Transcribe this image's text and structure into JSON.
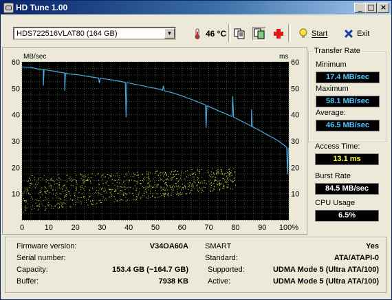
{
  "window": {
    "title": "HD Tune 1.00"
  },
  "toolbar": {
    "drive": "HDS722516VLAT80 (164 GB)",
    "temperature": "46 °C",
    "start_label": "Start",
    "exit_label": "Exit"
  },
  "chart_data": {
    "type": "line",
    "ylabel_left": "MB/sec",
    "ylabel_right": "ms",
    "y_ticks": [
      "60",
      "50",
      "40",
      "30",
      "20",
      "10"
    ],
    "y_ticks_right": [
      "60",
      "50",
      "40",
      "30",
      "20",
      "10"
    ],
    "x_ticks": [
      "0",
      "10",
      "20",
      "30",
      "40",
      "50",
      "60",
      "70",
      "80",
      "90",
      "100%"
    ],
    "ylim": [
      0,
      60
    ],
    "xlim": [
      0,
      100
    ],
    "grid": true,
    "transfer_rate": {
      "x": [
        0,
        2,
        4,
        5,
        6,
        7,
        8,
        9,
        10,
        12,
        14,
        16,
        18,
        20,
        22,
        24,
        26,
        28,
        30,
        32,
        34,
        36,
        38,
        40,
        42,
        44,
        46,
        48,
        50,
        52,
        54,
        56,
        58,
        60,
        62,
        64,
        66,
        68,
        70,
        72,
        74,
        76,
        78,
        80,
        82,
        84,
        86,
        88,
        90,
        92,
        94,
        96,
        98,
        100
      ],
      "y": [
        58.1,
        58,
        57.8,
        57.5,
        57.3,
        57.2,
        57.1,
        57,
        56.8,
        56.5,
        56.1,
        55.8,
        55.4,
        55.2,
        55,
        54.6,
        54.3,
        54,
        53.8,
        53.4,
        53.1,
        52.8,
        52.4,
        52,
        51.6,
        51.2,
        50.8,
        50.3,
        50,
        49.5,
        48.9,
        48.4,
        47.8,
        47.1,
        46.3,
        45.6,
        44.8,
        44,
        43.1,
        42.2,
        41.3,
        40.5,
        39.6,
        38.7,
        37.7,
        36.7,
        35.6,
        34.6,
        33.5,
        32.3,
        31.3,
        30.1,
        28.6,
        27
      ]
    },
    "dips": [
      {
        "x": 8,
        "y": 51
      },
      {
        "x": 16,
        "y": 49
      },
      {
        "x": 29,
        "y": 52
      },
      {
        "x": 39,
        "y": 39
      },
      {
        "x": 53,
        "y": 51
      },
      {
        "x": 69,
        "y": 35
      },
      {
        "x": 79,
        "y": 47
      },
      {
        "x": 86,
        "y": 42
      },
      {
        "x": 99.5,
        "y": 17.4
      }
    ],
    "access_scatter_band": {
      "x_range": [
        0,
        80
      ],
      "y_min_start": 3,
      "y_max_start": 17,
      "y_min_end": 12,
      "y_max_end": 20
    },
    "series_colors": {
      "transfer_rate": "#4AA8E0",
      "access_time": "#E8E84A",
      "background": "#000000",
      "grid": "#3A5A3A"
    }
  },
  "stats": {
    "transfer_rate_label": "Transfer Rate",
    "minimum_label": "Minimum",
    "minimum": "17.4 MB/sec",
    "maximum_label": "Maximum",
    "maximum": "58.1 MB/sec",
    "average_label": "Average:",
    "average": "46.5 MB/sec",
    "access_time_label": "Access Time:",
    "access_time": "13.1 ms",
    "burst_rate_label": "Burst Rate",
    "burst_rate": "84.5 MB/sec",
    "cpu_usage_label": "CPU Usage",
    "cpu_usage": "6.5%"
  },
  "info": {
    "firmware_label": "Firmware version:",
    "firmware": "V34OA60A",
    "serial_label": "Serial number:",
    "serial": "",
    "capacity_label": "Capacity:",
    "capacity": "153.4 GB (~164.7 GB)",
    "buffer_label": "Buffer:",
    "buffer": "7938 KB",
    "smart_label": "SMART",
    "smart": "Yes",
    "standard_label": "Standard:",
    "standard": "ATA/ATAPI-0",
    "supported_label": "Supported:",
    "supported": "UDMA Mode 5 (Ultra ATA/100)",
    "active_label": "Active:",
    "active": "UDMA Mode 5 (Ultra ATA/100)"
  }
}
